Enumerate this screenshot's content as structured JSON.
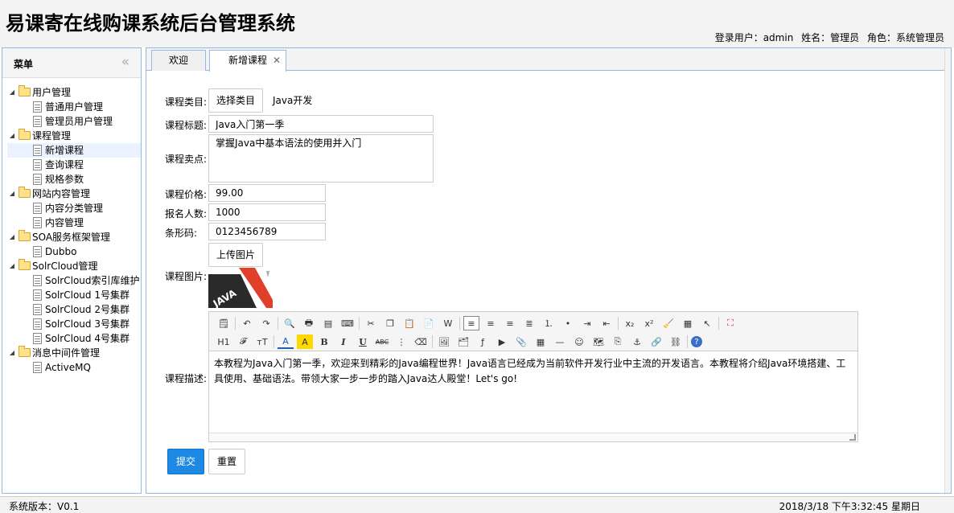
{
  "header": {
    "title": "易课寄在线购课系统后台管理系统",
    "login_user": "登录用户：admin",
    "name": "姓名：管理员",
    "role": "角色：系统管理员"
  },
  "sidebar": {
    "title": "菜单",
    "collapse_icon": "«",
    "tree": [
      {
        "label": "用户管理",
        "children": [
          "普通用户管理",
          "管理员用户管理"
        ]
      },
      {
        "label": "课程管理",
        "children": [
          "新增课程",
          "查询课程",
          "规格参数"
        ]
      },
      {
        "label": "网站内容管理",
        "children": [
          "内容分类管理",
          "内容管理"
        ]
      },
      {
        "label": "SOA服务框架管理",
        "children": [
          "Dubbo"
        ]
      },
      {
        "label": "SolrCloud管理",
        "children": [
          "SolrCloud索引库维护",
          "SolrCloud 1号集群",
          "SolrCloud 2号集群",
          "SolrCloud 3号集群",
          "SolrCloud 4号集群"
        ]
      },
      {
        "label": "消息中间件管理",
        "children": [
          "ActiveMQ"
        ]
      }
    ],
    "selected": "新增课程"
  },
  "tabs": [
    {
      "label": "欢迎"
    },
    {
      "label": "新增课程",
      "active": true
    }
  ],
  "form": {
    "category_label": "课程类目:",
    "category_button": "选择类目",
    "category_value": "Java开发",
    "title_label": "课程标题:",
    "title_value": "Java入门第一季",
    "selling_label": "课程卖点:",
    "selling_value": "掌握Java中基本语法的使用并入门",
    "price_label": "课程价格:",
    "price_value": "99.00",
    "enroll_label": "报名人数:",
    "enroll_value": "1000",
    "barcode_label": "条形码:",
    "barcode_value": "0123456789",
    "image_label": "课程图片:",
    "upload_button": "上传图片",
    "desc_label": "课程描述:",
    "desc_value": "本教程为Java入门第一季，欢迎来到精彩的Java编程世界！Java语言已经成为当前软件开发行业中主流的开发语言。本教程将介绍Java环境搭建、工具使用、基础语法。带领大家一步一步的踏入Java达人殿堂！Let's go!",
    "submit_button": "提交",
    "reset_button": "重置"
  },
  "editor_toolbar": {
    "row1": [
      "source-icon",
      "undo-icon",
      "redo-icon",
      "preview-icon",
      "print-icon",
      "template-icon",
      "code-icon",
      "cut-icon",
      "copy-icon",
      "paste-icon",
      "paste-plain-icon",
      "paste-word-icon",
      "align-left-icon",
      "align-center-icon",
      "align-right-icon",
      "align-justify-icon",
      "ordered-list-icon",
      "unordered-list-icon",
      "indent-icon",
      "outdent-icon",
      "subscript-icon",
      "superscript-icon",
      "clear-format-icon",
      "select-all-icon",
      "select-icon",
      "fullscreen-icon"
    ],
    "row2": [
      "heading-icon",
      "font-family-icon",
      "font-size-icon",
      "font-color-icon",
      "highlight-icon",
      "bold-icon",
      "italic-icon",
      "underline-icon",
      "strikethrough-icon",
      "line-height-icon",
      "remove-format-icon",
      "image-icon",
      "multi-image-icon",
      "flash-icon",
      "media-icon",
      "attachment-icon",
      "table-icon",
      "hr-icon",
      "emoticon-icon",
      "map-icon",
      "page-break-icon",
      "anchor-icon",
      "link-icon",
      "unlink-icon",
      "help-icon"
    ],
    "labels": {
      "heading": "H1",
      "font_size": "тT",
      "bold": "B",
      "italic": "I",
      "underline": "U",
      "strike": "ABC",
      "sub": "x₂",
      "sup": "x²"
    }
  },
  "footer": {
    "version": "系统版本：V0.1",
    "datetime": "2018/3/18 下午3:32:45 星期日"
  }
}
